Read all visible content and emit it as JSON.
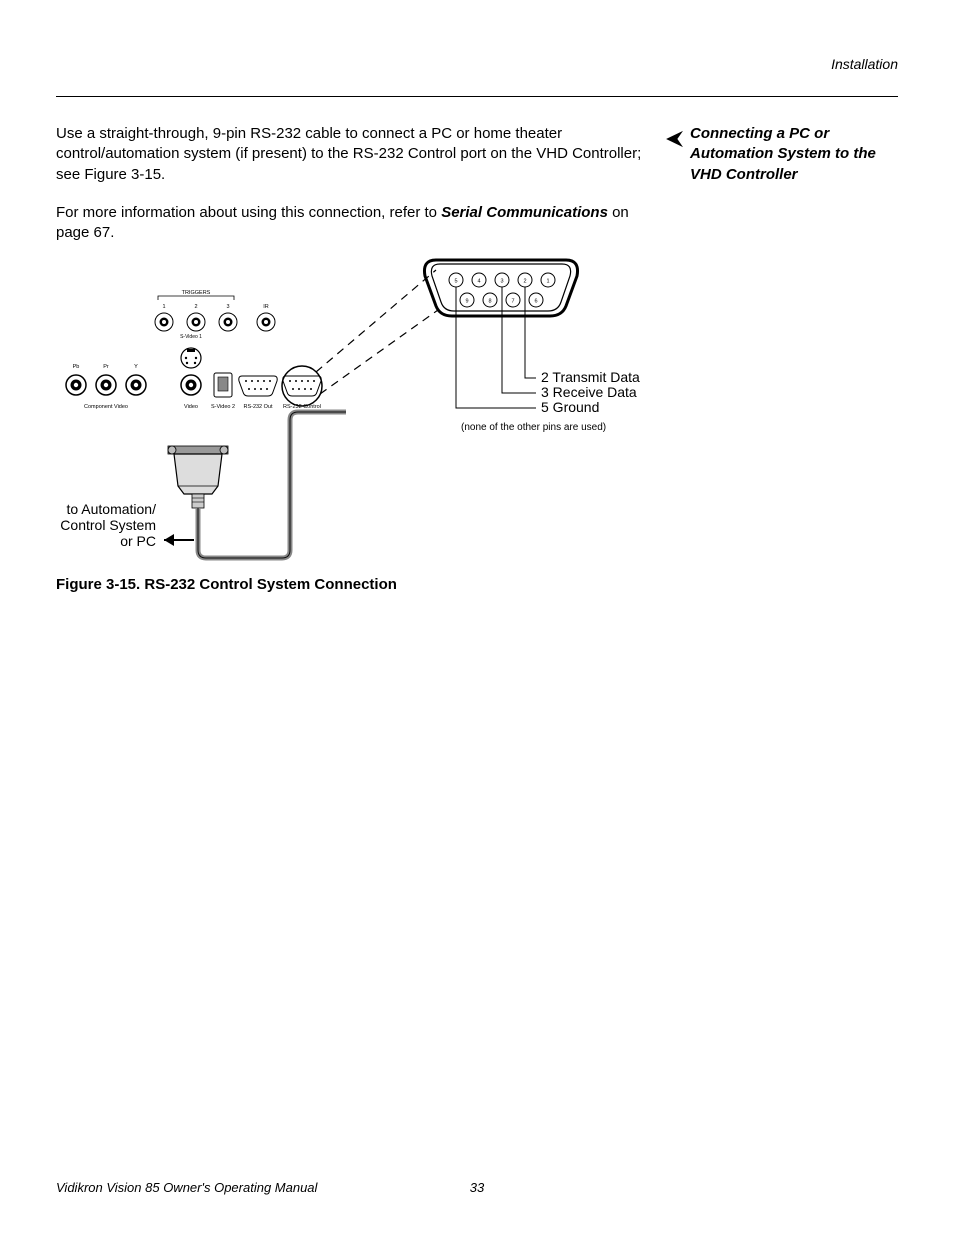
{
  "header": {
    "section": "Installation"
  },
  "sidebar": {
    "heading": "Connecting a PC or Automation System to the VHD Controller"
  },
  "body": {
    "p1a": "Use a straight-through, 9-pin RS-232 cable to connect a PC or home theater control/automation system (if present) to the RS-232 Control port on the VHD Controller; see Figure 3-15.",
    "p2a": "For more information about using this connection, refer to ",
    "p2b": "Serial Communications",
    "p2c": " on page 67."
  },
  "figure": {
    "caption": "Figure 3-15. RS-232 Control System Connection",
    "panel": {
      "triggers_label": "TRIGGERS",
      "trigger_nums": [
        "1",
        "2",
        "3"
      ],
      "ir_label": "IR",
      "row2_labels": {
        "pb": "Pb",
        "pr": "Pr",
        "y": "Y"
      },
      "bottom_labels": {
        "component": "Component Video",
        "video": "Video",
        "svideo1": "S-Video 1",
        "svideo2": "S-Video 2",
        "rs232out": "RS-232 Out",
        "rs232ctrl": "RS-232 Control"
      }
    },
    "db9": {
      "top_pins": [
        "5",
        "4",
        "3",
        "2",
        "1"
      ],
      "bottom_pins": [
        "9",
        "8",
        "7",
        "6"
      ],
      "pin2": "2 Transmit Data",
      "pin3": "3 Receive Data",
      "pin5": "5 Ground",
      "note": "(none of the other pins are used)"
    },
    "cable_label": {
      "l1": "to Automation/",
      "l2": "Control System",
      "l3": "or PC"
    }
  },
  "footer": {
    "manual": "Vidikron Vision 85 Owner's Operating Manual",
    "page": "33"
  }
}
